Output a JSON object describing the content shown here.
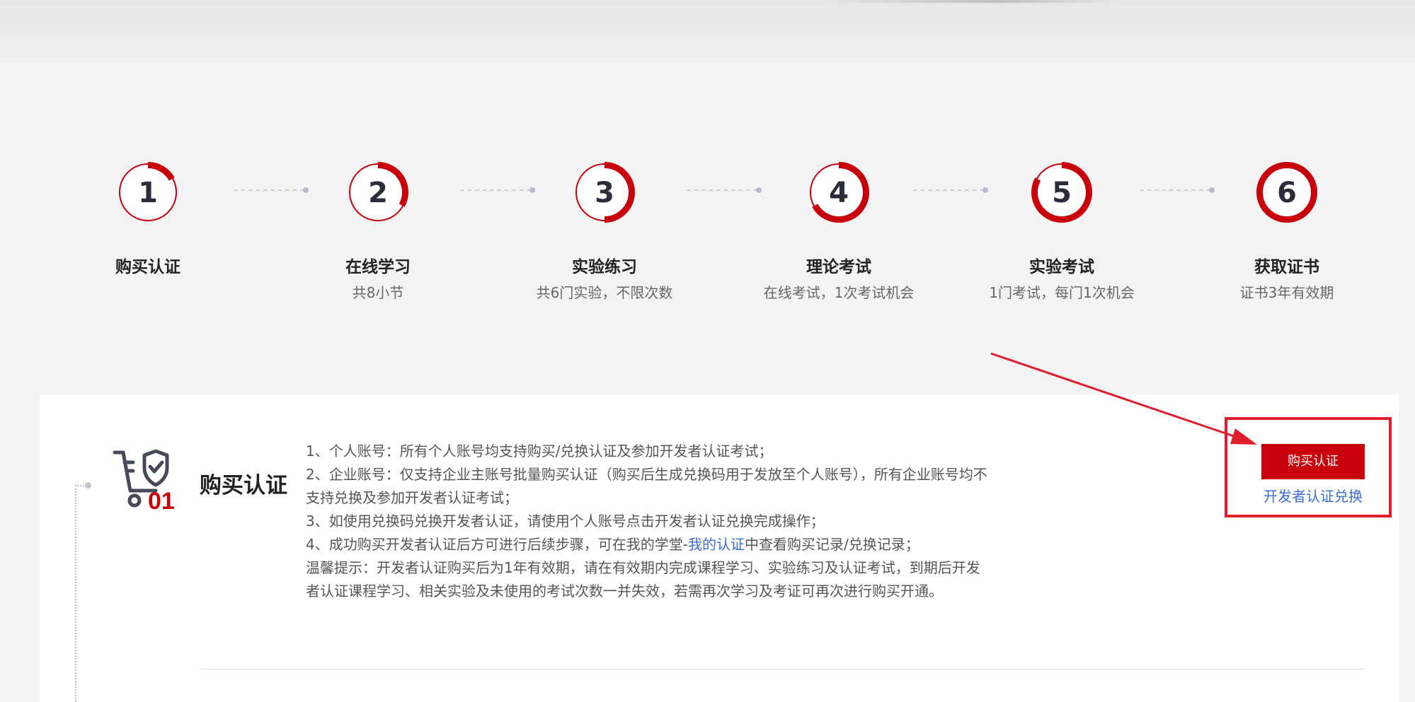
{
  "steps": [
    {
      "number": "1",
      "title": "购买认证",
      "subtitle": "",
      "progress": 0.17
    },
    {
      "number": "2",
      "title": "在线学习",
      "subtitle": "共8小节",
      "progress": 0.33
    },
    {
      "number": "3",
      "title": "实验练习",
      "subtitle": "共6门实验，不限次数",
      "progress": 0.5
    },
    {
      "number": "4",
      "title": "理论考试",
      "subtitle": "在线考试，1次考试机会",
      "progress": 0.67
    },
    {
      "number": "5",
      "title": "实验考试",
      "subtitle": "1门考试，每门1次机会",
      "progress": 0.83
    },
    {
      "number": "6",
      "title": "获取证书",
      "subtitle": "证书3年有效期",
      "progress": 1.0
    }
  ],
  "section": {
    "title": "购买认证",
    "icon_number": "01",
    "notes": {
      "line1": "1、个人账号：所有个人账号均支持购买/兑换认证及参加开发者认证考试；",
      "line2": "2、企业账号：仅支持企业主账号批量购买认证（购买后生成兑换码用于发放至个人账号），所有企业账号均不支持兑换及参加开发者认证考试；",
      "line3": "3、如使用兑换码兑换开发者认证，请使用个人账号点击开发者认证兑换完成操作；",
      "line4_prefix": "4、成功购买开发者认证后方可进行后续步骤，可在我的学堂-",
      "line4_link": "我的认证",
      "line4_suffix": "中查看购买记录/兑换记录；",
      "tip": "温馨提示：开发者认证购买后为1年有效期，请在有效期内完成课程学习、实验练习及认证考试，到期后开发者认证课程学习、相关实验及未使用的考试次数一并失效，若需再次学习及考证可再次进行购买开通。"
    }
  },
  "actions": {
    "buy_label": "购买认证",
    "redeem_label": "开发者认证兑换"
  },
  "colors": {
    "accent": "#c7000b",
    "link": "#3a6bd6",
    "annotation": "#e01d2a"
  }
}
